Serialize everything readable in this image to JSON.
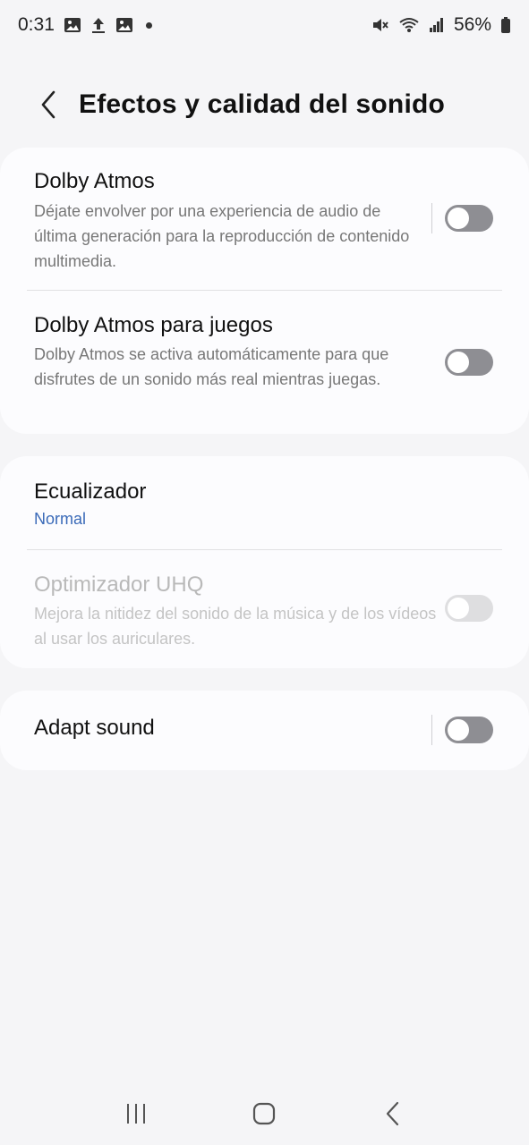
{
  "status_bar": {
    "time": "0:31",
    "icons_left": [
      "image-icon",
      "upload-icon",
      "image-icon",
      "notification-dot"
    ],
    "icons_right": [
      "mute-icon",
      "wifi-icon",
      "signal-icon",
      "battery-icon"
    ],
    "battery": "56%"
  },
  "header": {
    "title": "Efectos y calidad del sonido"
  },
  "card1": {
    "dolby": {
      "title": "Dolby Atmos",
      "description": "Déjate envolver por una experiencia de audio de última generación para la reproducción de contenido multimedia.",
      "enabled": false
    },
    "dolby_games": {
      "title": "Dolby Atmos para juegos",
      "description": "Dolby Atmos se activa automáticamente para que disfrutes de un sonido más real mientras juegas.",
      "enabled": false
    }
  },
  "card2": {
    "equalizer": {
      "title": "Ecualizador",
      "value": "Normal"
    },
    "uhq": {
      "title": "Optimizador UHQ",
      "description": "Mejora la nitidez del sonido de la música y de los vídeos al usar los auriculares.",
      "enabled": false,
      "disabled": true
    }
  },
  "card3": {
    "adapt": {
      "title": "Adapt sound",
      "enabled": false
    }
  },
  "colors": {
    "accent": "#3a6ab8",
    "toggle_off": "#8e8e93",
    "background": "#f5f5f7"
  }
}
